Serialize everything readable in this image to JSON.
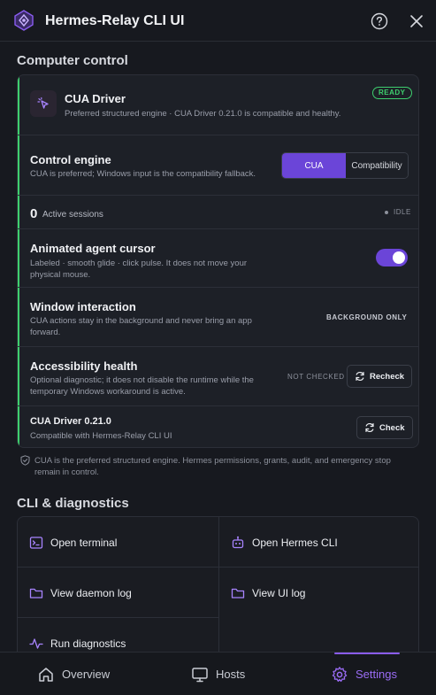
{
  "window": {
    "title": "Hermes-Relay CLI UI"
  },
  "computer_control": {
    "heading": "Computer control",
    "driver": {
      "name": "CUA Driver",
      "description": "Preferred structured engine · CUA Driver 0.21.0 is compatible and healthy.",
      "status": "READY"
    },
    "control_engine": {
      "title": "Control engine",
      "description": "CUA is preferred; Windows input is the compatibility fallback.",
      "options": [
        "CUA",
        "Compatibility"
      ],
      "selected": "CUA"
    },
    "sessions": {
      "count": "0",
      "label": "Active sessions",
      "state": "IDLE"
    },
    "cursor": {
      "title": "Animated agent cursor",
      "description": "Labeled · smooth glide · click pulse. It does not move your physical mouse.",
      "enabled": true
    },
    "window_interaction": {
      "title": "Window interaction",
      "description": "CUA actions stay in the background and never bring an app forward.",
      "value": "BACKGROUND ONLY"
    },
    "accessibility": {
      "title": "Accessibility health",
      "description": "Optional diagnostic; it does not disable the runtime while the temporary Windows workaround is active.",
      "status": "NOT CHECKED",
      "button": "Recheck"
    },
    "version": {
      "title": "CUA Driver 0.21.0",
      "description": "Compatible with Hermes-Relay CLI UI",
      "button": "Check"
    },
    "note": "CUA is the preferred structured engine. Hermes permissions, grants, audit, and emergency stop remain in control."
  },
  "cli": {
    "heading": "CLI & diagnostics",
    "actions": [
      "Open terminal",
      "Open Hermes CLI",
      "View daemon log",
      "View UI log",
      "Run diagnostics"
    ]
  },
  "nav": {
    "items": [
      "Overview",
      "Hosts",
      "Settings"
    ],
    "active": "Settings"
  },
  "colors": {
    "accent": "#6b45d8",
    "success": "#3ecf6e",
    "background": "#17191f"
  }
}
